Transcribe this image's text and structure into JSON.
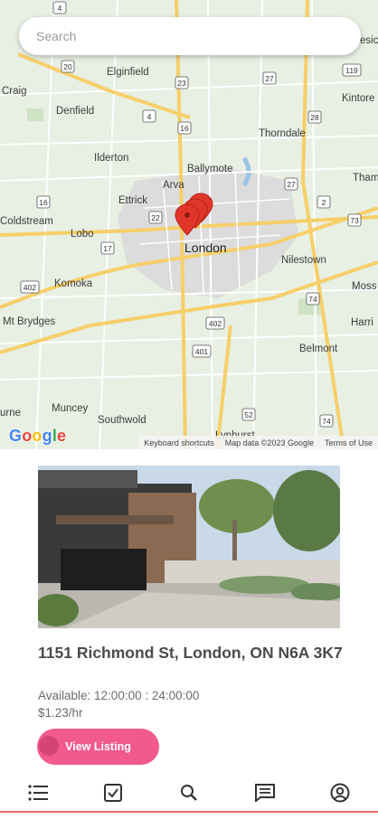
{
  "search": {
    "placeholder": "Search"
  },
  "map": {
    "place_labels": [
      "Elginfield",
      "Craig",
      "Denfield",
      "Thorndale",
      "Kintore",
      "Ilderton",
      "Ballymote",
      "Tham",
      "Arva",
      "Ettrick",
      "Coldstream",
      "Lobo",
      "London",
      "Nilestown",
      "Komoka",
      "Moss",
      "Mt Brydges",
      "Harri",
      "Belmont",
      "Muncey",
      "Southwold",
      "Lynhurst",
      "urne",
      "esic"
    ],
    "road_numbers": [
      "4",
      "20",
      "23",
      "27",
      "119",
      "28",
      "4",
      "16",
      "27",
      "2",
      "16",
      "22",
      "17",
      "73",
      "402",
      "74",
      "402",
      "401",
      "52",
      "74"
    ],
    "google_logo": "Google",
    "footer": {
      "shortcuts": "Keyboard shortcuts",
      "map_data": "Map data ©2023 Google",
      "terms": "Terms of Use"
    },
    "colors": {
      "land": "#e8efe3",
      "city": "#dcdcdc",
      "highway": "#f6cf6a",
      "road": "#ffffff",
      "marker": "#e0362a"
    }
  },
  "listing": {
    "address": "1151 Richmond St, London, ON N6A 3K7",
    "availability": "Available: 12:00:00 : 24:00:00",
    "price": "$1.23/hr",
    "button_label": "View Listing"
  },
  "nav": {
    "items": [
      "list-icon",
      "checkbox-icon",
      "search-icon",
      "chat-icon",
      "profile-icon"
    ]
  },
  "colors": {
    "accent": "#f25a8f",
    "text": "#4b4b4b"
  }
}
